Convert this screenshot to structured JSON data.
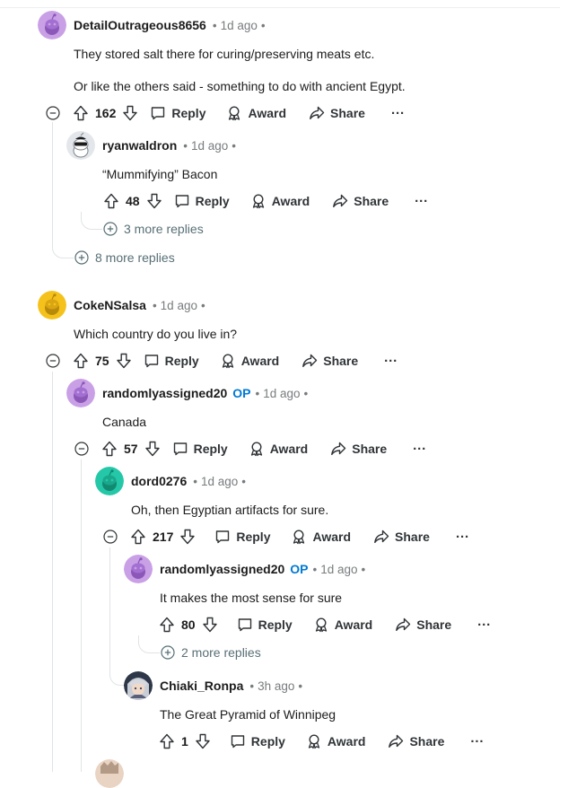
{
  "comments": [
    {
      "user": "DetailOutrageous8656",
      "op": "",
      "time": "1d ago",
      "lines": [
        "They stored salt there for curing/preserving meats etc.",
        "Or like the others said - something to do with ancient Egypt."
      ],
      "votes": "162"
    },
    {
      "user": "ryanwaldron",
      "op": "",
      "time": "1d ago",
      "lines": [
        "“Mummifying” Bacon"
      ],
      "votes": "48"
    },
    {
      "user": "CokeNSalsa",
      "op": "",
      "time": "1d ago",
      "lines": [
        "Which country do you live in?"
      ],
      "votes": "75"
    },
    {
      "user": "randomlyassigned20",
      "op": "OP",
      "time": "1d ago",
      "lines": [
        "Canada"
      ],
      "votes": "57"
    },
    {
      "user": "dord0276",
      "op": "",
      "time": "1d ago",
      "lines": [
        "Oh, then Egyptian artifacts for sure."
      ],
      "votes": "217"
    },
    {
      "user": "randomlyassigned20",
      "op": "OP",
      "time": "1d ago",
      "lines": [
        "It makes the most sense for sure"
      ],
      "votes": "80"
    },
    {
      "user": "Chiaki_Ronpa",
      "op": "",
      "time": "3h ago",
      "lines": [
        "The Great Pyramid of Winnipeg"
      ],
      "votes": "1"
    }
  ],
  "more_replies": [
    "3 more replies",
    "8 more replies",
    "2 more replies"
  ],
  "actions": {
    "reply": "Reply",
    "award": "Award",
    "share": "Share",
    "more": "···"
  },
  "separator": "•",
  "colors": {
    "avatar_purple": "#c9a0e6",
    "avatar_yellow": "#f5c21b",
    "avatar_teal": "#24c8a8",
    "op": "#0079d3",
    "text": "#1c1c1c",
    "meta": "#787c7e",
    "thread_line": "#e0e3e6"
  },
  "icons": [
    "collapse-icon",
    "upvote-icon",
    "downvote-icon",
    "reply-bubble-icon",
    "award-icon",
    "share-icon",
    "ellipsis-icon",
    "expand-plus-icon",
    "snoo-avatar-icon"
  ]
}
